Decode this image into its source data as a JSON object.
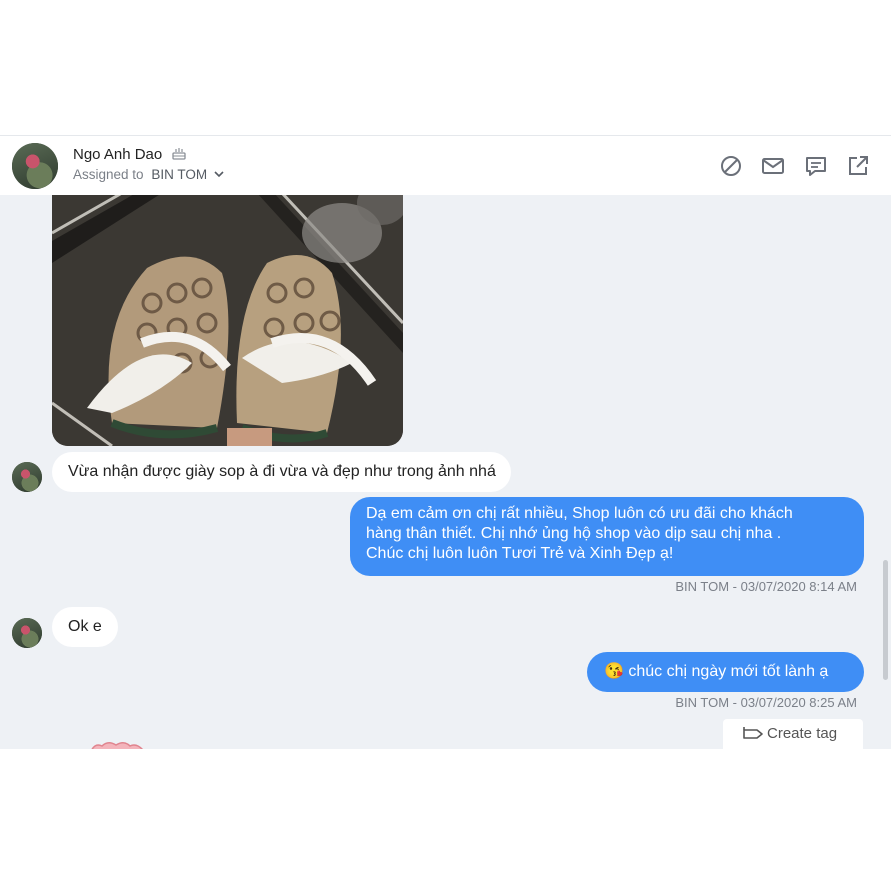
{
  "header": {
    "contact_name": "Ngo Anh Dao",
    "assigned_prefix": "Assigned to",
    "assigned_to": "BIN TOM",
    "icons": [
      "block-icon",
      "mail-icon",
      "comment-icon",
      "external-link-icon"
    ]
  },
  "messages": [
    {
      "direction": "incoming",
      "text": "Vừa nhận được giày sop à đi vừa và đẹp như trong ảnh nhá"
    },
    {
      "direction": "outgoing",
      "lines": [
        "Dạ em cảm ơn chị rất nhiều, Shop luôn có ưu đãi cho khách",
        "hàng thân thiết. Chị nhớ ủng hộ shop vào dịp sau chị nha .",
        "Chúc chị luôn luôn Tươi Trẻ và Xinh Đẹp ạ!"
      ],
      "meta": "BIN TOM - 03/07/2020 8:14 AM"
    },
    {
      "direction": "incoming",
      "text": "Ok e"
    },
    {
      "direction": "outgoing",
      "emoji": "😘",
      "text": "chúc chị ngày mới tốt lành ạ",
      "meta": "BIN TOM - 03/07/2020 8:25 AM"
    }
  ],
  "footer": {
    "create_tag_label": "Create tag"
  },
  "colors": {
    "outgoing_bubble": "#3f8ef5",
    "background": "#eef1f5"
  }
}
